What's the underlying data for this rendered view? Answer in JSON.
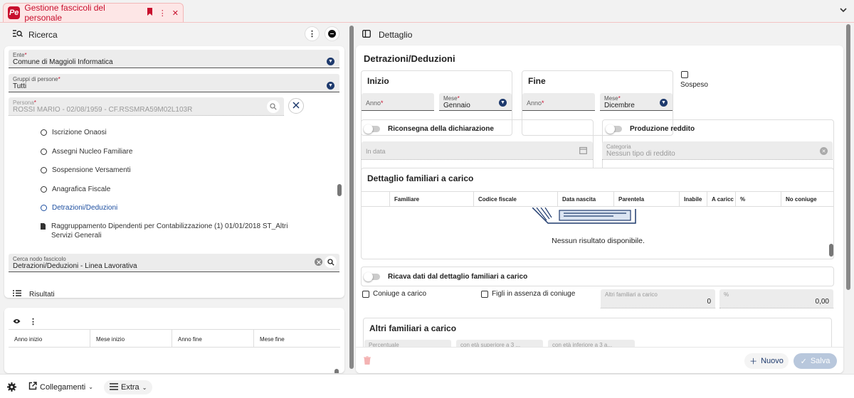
{
  "app": {
    "logo": "Pe",
    "title": "Gestione fascicoli del personale"
  },
  "left": {
    "header": "Ricerca",
    "ente": {
      "label": "Ente",
      "value": "Comune di Maggioli Informatica"
    },
    "gruppi": {
      "label": "Gruppi di persone",
      "value": "Tutti"
    },
    "persona": {
      "label": "Persona",
      "value": "ROSSI MARIO - 02/08/1959 - CF.RSSMRA59M02L103R"
    },
    "tree": [
      {
        "label": "Iscrizione Onaosi",
        "kind": "radio"
      },
      {
        "label": "Assegni Nucleo Familiare",
        "kind": "radio"
      },
      {
        "label": "Sospensione Versamenti",
        "kind": "radio"
      },
      {
        "label": "Anagrafica Fiscale",
        "kind": "radio"
      },
      {
        "label": "Detrazioni/Deduzioni",
        "kind": "radio",
        "active": true
      },
      {
        "label": "Raggruppamento Dipendenti per Contabilizzazione (1) 01/01/2018  ST_Altri Servizi Generali",
        "kind": "doc"
      }
    ],
    "search_node": {
      "label": "Cerca nodo fascicolo",
      "value": "Detrazioni/Deduzioni  - Linea Lavorativa"
    },
    "results": {
      "header": "Risultati",
      "columns": [
        "Anno inizio",
        "Mese inizio",
        "Anno fine",
        "Mese fine"
      ]
    }
  },
  "right": {
    "header": "Dettaglio",
    "section": "Detrazioni/Deduzioni",
    "inizio": {
      "title": "Inizio",
      "anno_label": "Anno",
      "mese_label": "Mese",
      "mese_value": "Gennaio"
    },
    "fine": {
      "title": "Fine",
      "anno_label": "Anno",
      "mese_label": "Mese",
      "mese_value": "Dicembre"
    },
    "sospeso": "Sospeso",
    "riconsegna": "Riconsegna della dichiarazione",
    "in_data": "In data",
    "produzione": "Produzione reddito",
    "categoria": {
      "label": "Categoria",
      "value": "Nessun tipo di reddito"
    },
    "familiari": {
      "title": "Dettaglio familiari a carico",
      "columns": [
        "Familiare",
        "Codice fiscale",
        "Data nascita",
        "Parentela",
        "Inabile",
        "A caricc",
        "%",
        "No coniuge"
      ],
      "empty": "Nessun risultato disponibile."
    },
    "ricava": "Ricava dati dal dettaglio familiari a carico",
    "coniuge": "Coniuge a carico",
    "figli": "Figli in assenza di coniuge",
    "altri_fam": {
      "label": "Altri familiari a carico",
      "value": "0"
    },
    "percent": {
      "label": "%",
      "value": "0,00"
    },
    "altri_section": "Altri familiari a carico",
    "percentuale": "Percentuale",
    "eta_sup": "con età superiore a 3 ...",
    "eta_inf": "con età inferiore a 3 a...",
    "nuovo": "Nuovo",
    "salva": "Salva"
  },
  "bottom": {
    "collegamenti": "Collegamenti",
    "extra": "Extra"
  },
  "colors": {
    "brand": "#c8102e",
    "accent": "#1e3a6d",
    "link": "#1e4fa0"
  }
}
